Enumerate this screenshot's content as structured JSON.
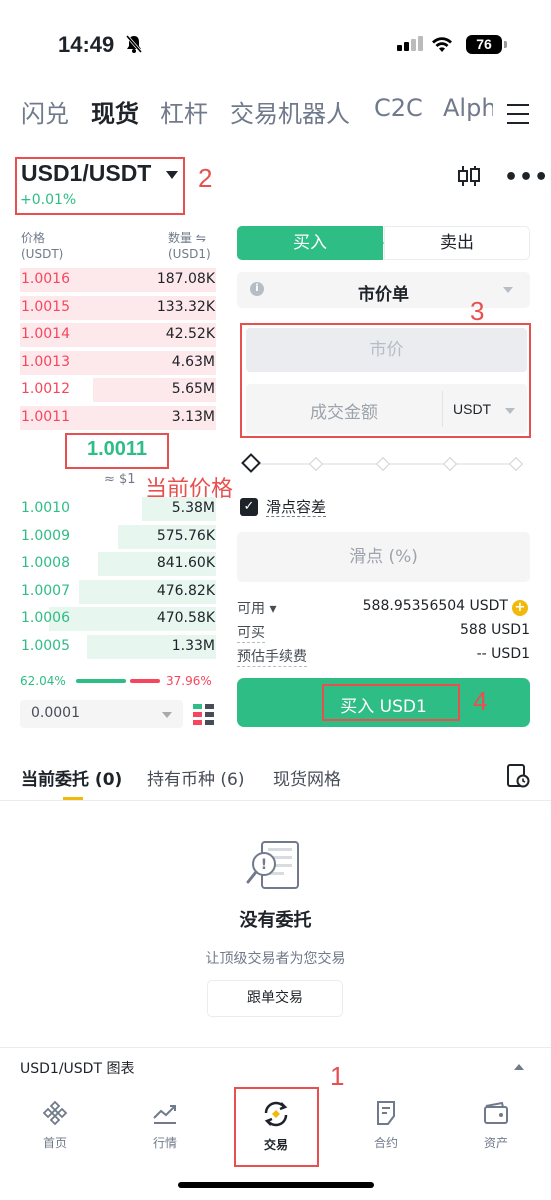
{
  "status_bar": {
    "time": "14:49",
    "battery": "76"
  },
  "top_tabs": [
    "闪兑",
    "现货",
    "杠杆",
    "交易机器人",
    "C2C",
    "Alph"
  ],
  "pair": {
    "name": "USD1/USDT",
    "change": "+0.01%"
  },
  "annotations": {
    "a1": "1",
    "a2": "2",
    "a3": "3",
    "a4": "4",
    "current_price_label": "当前价格"
  },
  "orderbook": {
    "price_header": "价格",
    "price_unit": "(USDT)",
    "qty_header": "数量",
    "qty_unit": "(USD1)",
    "asks": [
      {
        "price": "1.0016",
        "qty": "187.08K",
        "depth": 1.0
      },
      {
        "price": "1.0015",
        "qty": "133.32K",
        "depth": 1.0
      },
      {
        "price": "1.0014",
        "qty": "42.52K",
        "depth": 1.0
      },
      {
        "price": "1.0013",
        "qty": "4.63M",
        "depth": 1.0
      },
      {
        "price": "1.0012",
        "qty": "5.65M",
        "depth": 0.63
      },
      {
        "price": "1.0011",
        "qty": "3.13M",
        "depth": 1.0
      }
    ],
    "current_price": "1.0011",
    "current_usd": "≈ $1",
    "bids": [
      {
        "price": "1.0010",
        "qty": "5.38M",
        "depth": 0.38
      },
      {
        "price": "1.0009",
        "qty": "575.76K",
        "depth": 0.5
      },
      {
        "price": "1.0008",
        "qty": "841.60K",
        "depth": 0.6
      },
      {
        "price": "1.0007",
        "qty": "476.82K",
        "depth": 0.7
      },
      {
        "price": "1.0006",
        "qty": "470.58K",
        "depth": 0.85
      },
      {
        "price": "1.0005",
        "qty": "1.33M",
        "depth": 0.66
      }
    ],
    "buy_ratio": "62.04%",
    "sell_ratio": "37.96%",
    "precision": "0.0001"
  },
  "order_form": {
    "buy_tab": "买入",
    "sell_tab": "卖出",
    "order_type": "市价单",
    "market_placeholder": "市价",
    "amount_placeholder": "成交金额",
    "amount_unit": "USDT",
    "slippage_checkbox": "滑点容差",
    "slippage_placeholder": "滑点 (%)",
    "available_label": "可用",
    "available_value": "588.95356504 USDT",
    "can_buy_label": "可买",
    "can_buy_value": "588 USD1",
    "fee_label": "预估手续费",
    "fee_value": "-- USD1",
    "submit": "买入 USD1"
  },
  "bottom_tabs": [
    "当前委托 (0)",
    "持有币种 (6)",
    "现货网格"
  ],
  "empty_state": {
    "title": "没有委托",
    "subtitle": "让顶级交易者为您交易",
    "button": "跟单交易"
  },
  "chart_row": "USD1/USDT 图表",
  "nav": [
    "首页",
    "行情",
    "交易",
    "合约",
    "资产"
  ],
  "colors": {
    "green": "#2ebd85",
    "red": "#f6465d",
    "annotation": "#e8504f",
    "yellow": "#f0b90b"
  }
}
